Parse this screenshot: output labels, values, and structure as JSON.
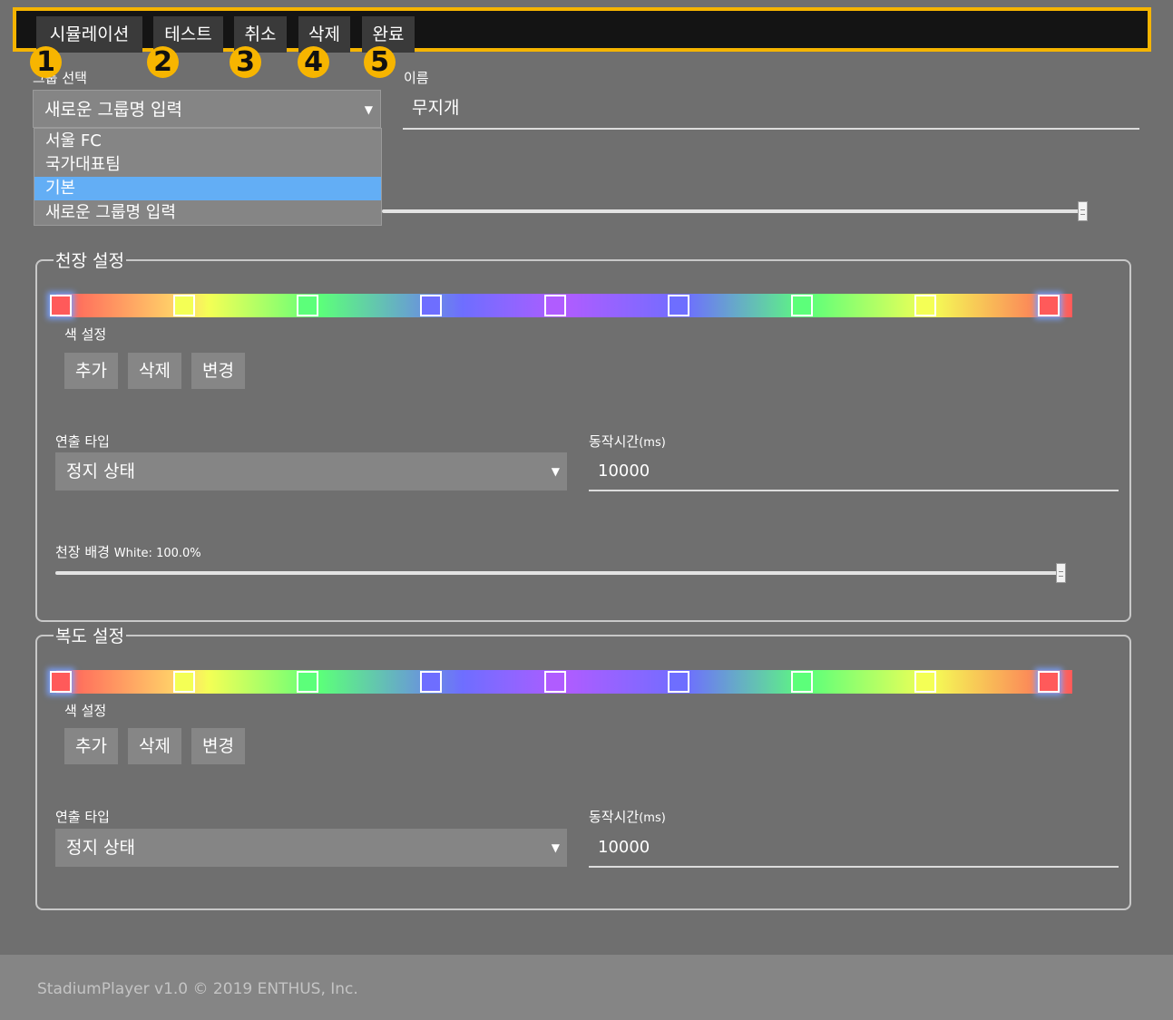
{
  "toolbar": {
    "buttons": [
      {
        "label": "시뮬레이션",
        "badge": "1"
      },
      {
        "label": "테스트",
        "badge": "2"
      },
      {
        "label": "취소",
        "badge": "3"
      },
      {
        "label": "삭제",
        "badge": "4"
      },
      {
        "label": "완료",
        "badge": "5"
      }
    ],
    "highlight_color": "#f5b400"
  },
  "group_select": {
    "label": "그룹 선택",
    "value": "새로운 그룹명 입력",
    "options": [
      "서울 FC",
      "국가대표팀",
      "기본",
      "새로운 그룹명 입력"
    ],
    "highlighted_option": "기본"
  },
  "name_field": {
    "label": "이름",
    "value": "무지개"
  },
  "top_slider": {
    "level": 1.0
  },
  "ceiling": {
    "title": "천장 설정",
    "color_label": "색 설정",
    "stop_colors": [
      "#ff5a5a",
      "#f4ff55",
      "#5cff7a",
      "#6e6eff",
      "#b05cff",
      "#6e6eff",
      "#5cff7a",
      "#f4ff55",
      "#ff5a5a"
    ],
    "buttons": {
      "add": "추가",
      "delete": "삭제",
      "change": "변경"
    },
    "effect_type_label": "연출 타입",
    "effect_type_value": "정지 상태",
    "duration_label_main": "동작시간",
    "duration_label_unit": "(ms)",
    "duration_value": "10000",
    "background_label": "천장 배경",
    "background_value": "White: 100.0%",
    "background_level": 1.0
  },
  "hallway": {
    "title": "복도 설정",
    "color_label": "색 설정",
    "stop_colors": [
      "#ff5a5a",
      "#f4ff55",
      "#5cff7a",
      "#6e6eff",
      "#b05cff",
      "#6e6eff",
      "#5cff7a",
      "#f4ff55",
      "#ff5a5a"
    ],
    "buttons": {
      "add": "추가",
      "delete": "삭제",
      "change": "변경"
    },
    "effect_type_label": "연출 타입",
    "effect_type_value": "정지 상태",
    "duration_label_main": "동작시간",
    "duration_label_unit": "(ms)",
    "duration_value": "10000"
  },
  "footer": {
    "text": "StadiumPlayer v1.0 © 2019 ENTHUS, Inc."
  }
}
